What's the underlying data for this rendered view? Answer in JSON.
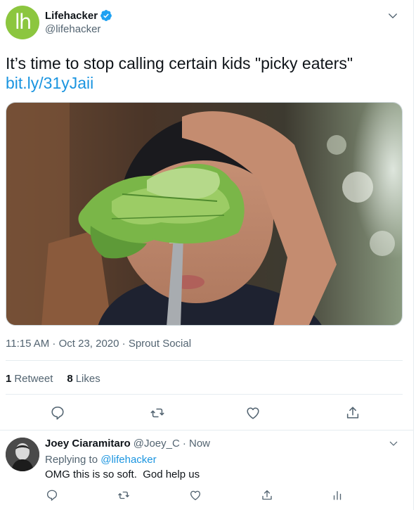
{
  "tweet": {
    "author_name": "Lifehacker",
    "author_handle": "@lifehacker",
    "avatar_text": "lh",
    "text": "It’s time to stop calling certain kids \"picky eaters\"",
    "link": "bit.ly/31yJaii",
    "image_alt": "Boy holding a fork with lettuce in front of his face",
    "timestamp": "11:15 AM · Oct 23, 2020",
    "separator": " · ",
    "source": "Sprout Social",
    "retweets_count": "1",
    "retweets_label": "Retweet",
    "likes_count": "8",
    "likes_label": "Likes"
  },
  "reply": {
    "author_name": "Joey Ciaramitaro",
    "author_handle": "@Joey_C",
    "time": "· Now",
    "replying_prefix": "Replying to",
    "replying_to": "@lifehacker",
    "text": "OMG this is so soft.  God help us"
  },
  "icons": {
    "verified": "verified-badge-icon",
    "caret": "chevron-down-icon",
    "reply": "reply-icon",
    "retweet": "retweet-icon",
    "like": "heart-icon",
    "share": "share-icon",
    "analytics": "analytics-icon"
  },
  "colors": {
    "brand": "#8cc63f",
    "link": "#1b95e0",
    "secondary_text": "#536471",
    "verified": "#1da1f2"
  }
}
